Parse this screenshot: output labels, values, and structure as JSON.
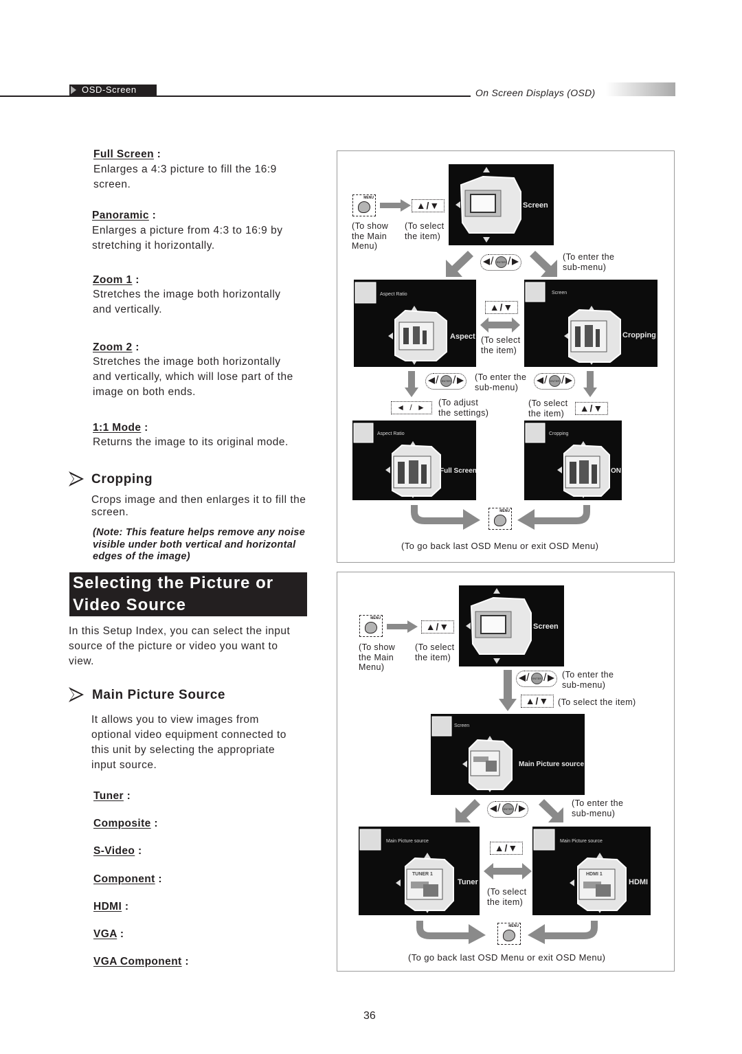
{
  "header": {
    "section_tab": "OSD-Screen",
    "chapter_title": "On Screen Displays (OSD)"
  },
  "aspect_modes": [
    {
      "term": "Full Screen",
      "desc": [
        "Enlarges a 4:3 picture to fill the 16:9",
        "screen."
      ]
    },
    {
      "term": "Panoramic",
      "desc": [
        "Enlarges a picture from 4:3 to 16:9 by",
        "stretching it horizontally."
      ]
    },
    {
      "term": "Zoom 1",
      "desc": [
        "Stretches the image both horizontally",
        "and vertically."
      ]
    },
    {
      "term": "Zoom 2",
      "desc": [
        "Stretches the image both horizontally",
        "and vertically, which will lose part of the",
        "image on both ends."
      ]
    },
    {
      "term": "1:1 Mode",
      "desc": [
        "Returns the image to its original mode."
      ]
    }
  ],
  "cropping": {
    "heading": "Cropping",
    "desc": [
      "Crops image and then enlarges it to fill the",
      "screen."
    ],
    "note": [
      "(Note: This feature helps remove any noise",
      "visible under both vertical and horizontal",
      "edges of the image)"
    ]
  },
  "source_section": {
    "banner": [
      "Selecting the Picture or",
      "Video Source"
    ],
    "intro": [
      "In this Setup Index, you can select the input",
      "source of the picture or video you want to",
      "view."
    ],
    "heading": "Main Picture Source",
    "desc": [
      "It allows you to view images from",
      "optional video equipment connected to",
      "this unit by selecting the appropriate",
      "input source."
    ],
    "sources": [
      "Tuner",
      "Composite",
      "S-Video",
      "Component",
      "HDMI",
      "VGA",
      "VGA Component"
    ]
  },
  "diagram1": {
    "cap_show_menu": [
      "(To show",
      "the Main",
      "Menu)"
    ],
    "cap_select_item": [
      "(To select",
      "the item)"
    ],
    "cap_enter_sub": [
      "(To enter the",
      "sub-menu)"
    ],
    "cap_select_item_mid": [
      "(To select",
      "the item)"
    ],
    "cap_enter_sub_mid": [
      "(To enter the",
      "sub-menu)"
    ],
    "cap_adjust": [
      "(To adjust",
      "the settings)"
    ],
    "cap_select_item_right": [
      "(To select",
      "the item)"
    ],
    "cap_back": "(To go back last OSD Menu or exit OSD Menu)",
    "screens": {
      "main": {
        "label": "Screen"
      },
      "aspect": {
        "title": "Aspect Ratio",
        "label": "Aspect"
      },
      "cropping": {
        "title": "Screen",
        "label": "Cropping"
      },
      "fullscreen": {
        "title": "Aspect Ratio",
        "label": "Full Screen"
      },
      "crop_on": {
        "title": "Cropping",
        "label": "ON"
      }
    }
  },
  "diagram2": {
    "cap_show_menu": [
      "(To show",
      "the Main",
      "Menu)"
    ],
    "cap_select_item": [
      "(To select",
      "the item)"
    ],
    "cap_enter_sub": [
      "(To enter the",
      "sub-menu)"
    ],
    "cap_select_item_inline": "(To select the item)",
    "cap_enter_sub2": [
      "(To enter the",
      "sub-menu)"
    ],
    "cap_select_item_mid": [
      "(To select",
      "the item)"
    ],
    "cap_back": "(To go back last OSD Menu or exit OSD Menu)",
    "screens": {
      "main": {
        "label": "Screen"
      },
      "mps": {
        "title": "Screen",
        "label": "Main Picture source"
      },
      "tuner": {
        "title": "Main Picture source",
        "label": "Tuner",
        "inner": "TUNER 1"
      },
      "hdmi": {
        "title": "Main Picture source",
        "label": "HDMI",
        "inner": "HDMI 1"
      }
    }
  },
  "buttons": {
    "menu_label": "MENU",
    "enter_label": "ENTER",
    "updown": "▲/▼",
    "leftright": "◄ / ►"
  },
  "page_number": "36"
}
